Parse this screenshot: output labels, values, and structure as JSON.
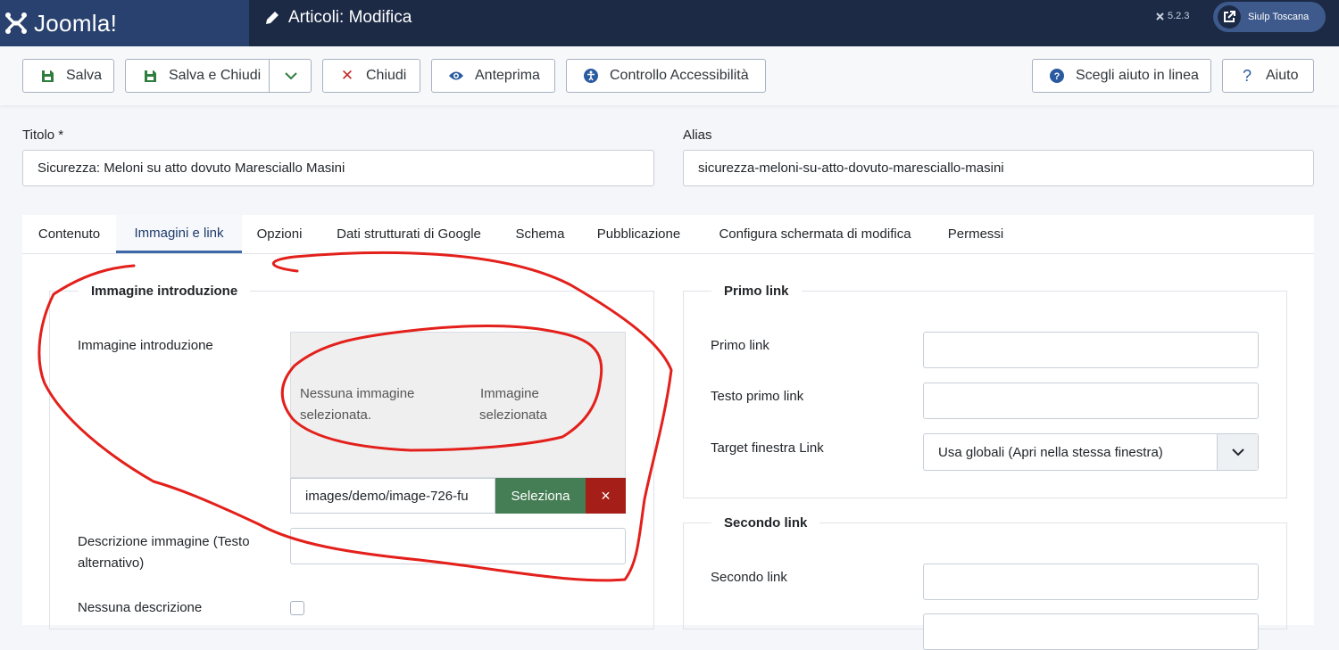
{
  "header": {
    "logo_text": "Joomla!",
    "page_title": "Articoli: Modifica",
    "version": "5.2.3",
    "user_label": "Siulp Toscana"
  },
  "toolbar": {
    "save": "Salva",
    "save_close": "Salva e Chiudi",
    "close": "Chiudi",
    "preview": "Anteprima",
    "accessibility": "Controllo Accessibilità",
    "help_online": "Scegli aiuto in linea",
    "help": "Aiuto"
  },
  "form": {
    "title_label": "Titolo *",
    "title_value": "Sicurezza: Meloni su atto dovuto Maresciallo Masini",
    "alias_label": "Alias",
    "alias_value": "sicurezza-meloni-su-atto-dovuto-maresciallo-masini"
  },
  "tabs": [
    "Contenuto",
    "Immagini e link",
    "Opzioni",
    "Dati strutturati di Google",
    "Schema",
    "Pubblicazione",
    "Configura schermata di modifica",
    "Permessi"
  ],
  "intro_image": {
    "legend": "Immagine introduzione",
    "field_label": "Immagine introduzione",
    "no_image_line1": "Nessuna immagine",
    "no_image_line2": "selezionata.",
    "alt_line1": "Immagine",
    "alt_line2": "selezionata",
    "path_value": "images/demo/image-726-fu",
    "select_button": "Seleziona",
    "clear_button": "×",
    "desc_label_line1": "Descrizione immagine (Testo",
    "desc_label_line2": "alternativo)",
    "no_desc_label": "Nessuna descrizione"
  },
  "link_a": {
    "legend": "Primo link",
    "link_label": "Primo link",
    "text_label": "Testo primo link",
    "target_label": "Target finestra Link",
    "target_value": "Usa globali (Apri nella stessa finestra)"
  },
  "link_b": {
    "legend": "Secondo link",
    "link_label": "Secondo link"
  },
  "colors": {
    "header_bg": "#1c2a46",
    "logo_bg": "#29416e",
    "select_green": "#457d54",
    "clear_red": "#a51f18",
    "annotation_red": "#e3201b"
  }
}
